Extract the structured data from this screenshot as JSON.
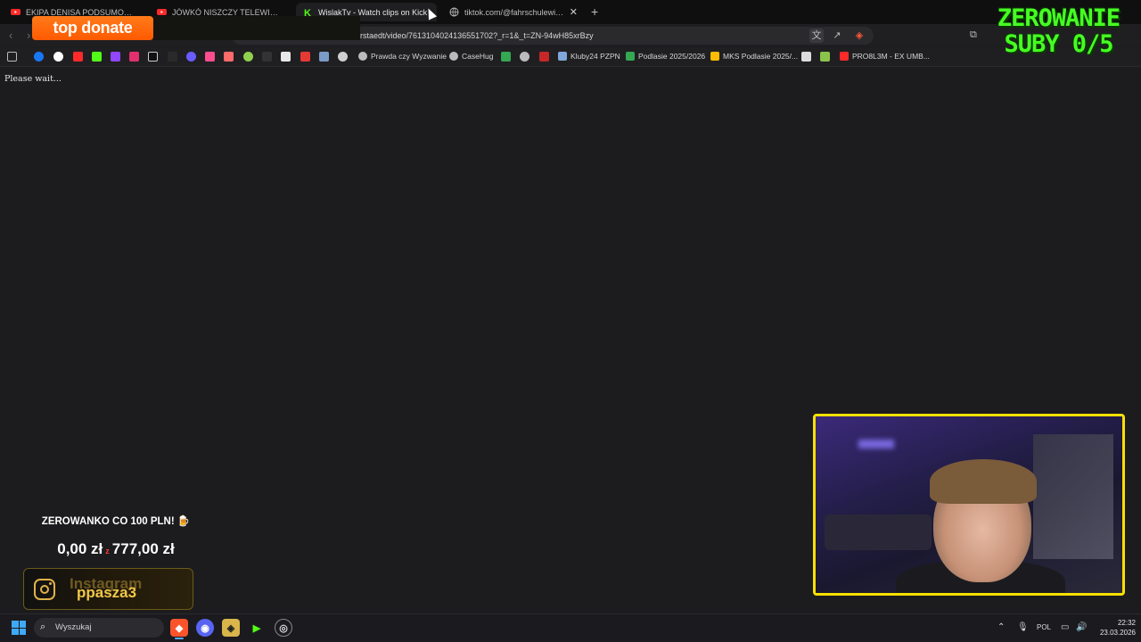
{
  "tabs": [
    {
      "label": "EKIPA DENISA PODSUMOWUJE WYG",
      "icon": "youtube-icon",
      "active": false
    },
    {
      "label": "JÓWKÓ NISZCZY TELEWIZOR#parszy",
      "icon": "youtube-icon",
      "active": false
    },
    {
      "label": "WislakTv - Watch clips on Kick",
      "icon": "kick-icon",
      "active": true
    },
    {
      "label": "tiktok.com/@fahrschulewilmerst",
      "icon": "globe-icon",
      "active": false
    }
  ],
  "address_bar": {
    "url": "rstaedt/video/7613104024136551702?_r=1&_t=ZN-94wH85xrBzy"
  },
  "bookmarks": {
    "items": [
      {
        "label": "Prawda czy Wyzwanie"
      },
      {
        "label": "CaseHug"
      },
      {
        "label": "Kluby24 PZPN"
      },
      {
        "label": "Podlasie 2025/2026"
      },
      {
        "label": "MKS Podlasie 2025/..."
      },
      {
        "label": "PRO8L3M - EX UMB..."
      }
    ]
  },
  "page": {
    "status_text": "Please wait..."
  },
  "overlay": {
    "top_donate_label": "top donate",
    "zero_title_line1": "ZEROWANIE",
    "zero_title_line2": "SUBY 0/5",
    "goal_title": "ZEROWANKO CO 100 PLN! 🍺",
    "goal_current": "0,00 zł",
    "goal_separator": "z",
    "goal_target": "777,00 zł",
    "instagram_label": "Instagram",
    "instagram_handle": "ppasza3"
  },
  "taskbar": {
    "search_placeholder": "Wyszukaj",
    "lang": "POL",
    "time": "22:32",
    "date": "23.03.2026"
  },
  "colors": {
    "accent_green": "#46ff23",
    "donate_orange": "#ff6a00",
    "cam_border": "#f7e000",
    "instagram_gold": "#f2c84a"
  }
}
